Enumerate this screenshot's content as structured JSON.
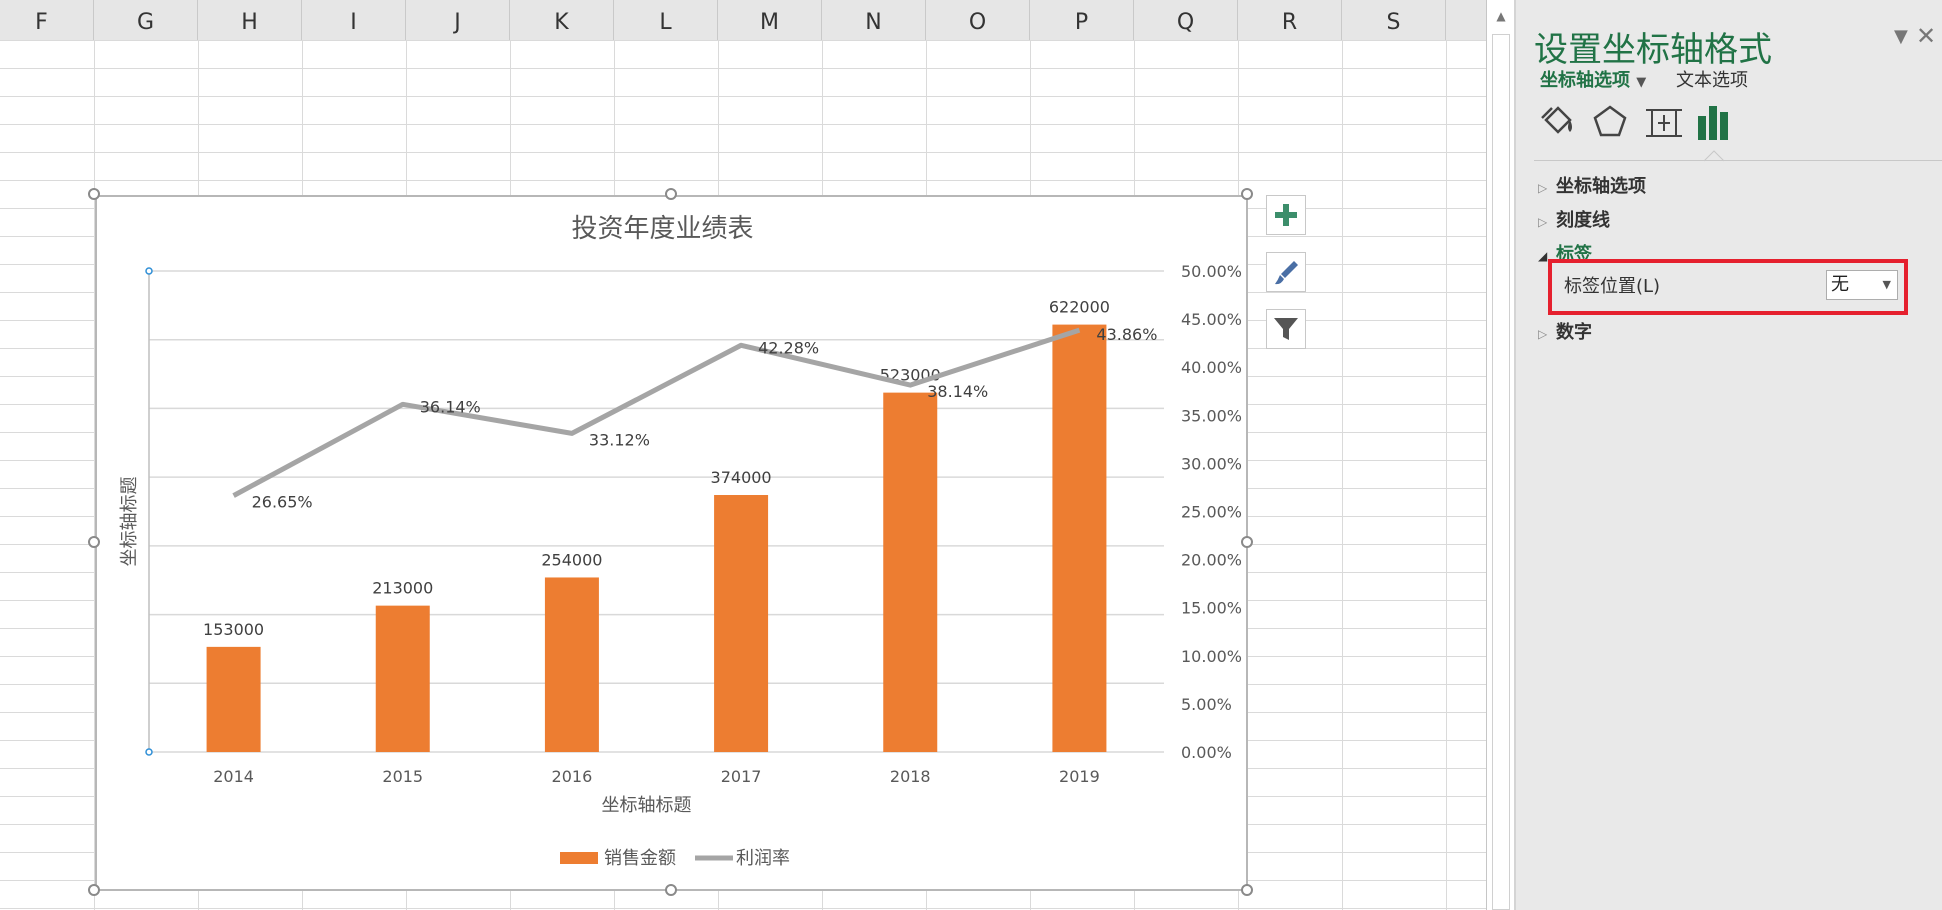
{
  "sheet": {
    "columns": [
      "F",
      "G",
      "H",
      "I",
      "J",
      "K",
      "L",
      "M",
      "N",
      "O",
      "P",
      "Q",
      "R",
      "S"
    ]
  },
  "chart": {
    "side_buttons": [
      {
        "name": "add-chart-element-button",
        "icon": "plus-icon"
      },
      {
        "name": "chart-styles-button",
        "icon": "brush-icon"
      },
      {
        "name": "chart-filters-button",
        "icon": "funnel-icon"
      }
    ]
  },
  "chart_data": {
    "type": "bar+line",
    "title": "投资年度业绩表",
    "categories": [
      "2014",
      "2015",
      "2016",
      "2017",
      "2018",
      "2019"
    ],
    "series": [
      {
        "name": "销售金额",
        "type": "bar",
        "axis": "left",
        "color": "#ED7D31",
        "values": [
          153000,
          213000,
          254000,
          374000,
          523000,
          622000
        ],
        "labels": [
          "153000",
          "213000",
          "254000",
          "374000",
          "523000",
          "622000"
        ]
      },
      {
        "name": "利润率",
        "type": "line",
        "axis": "right",
        "color": "#A5A5A5",
        "values": [
          26.65,
          36.14,
          33.12,
          42.28,
          38.14,
          43.86
        ],
        "labels": [
          "26.65%",
          "36.14%",
          "33.12%",
          "42.28%",
          "38.14%",
          "43.86%"
        ]
      }
    ],
    "xlabel": "坐标轴标题",
    "ylabel": "坐标轴标题",
    "ylim_left": [
      0,
      700000
    ],
    "ylim_right": [
      0,
      50
    ],
    "right_ticks": [
      "0.00%",
      "5.00%",
      "10.00%",
      "15.00%",
      "20.00%",
      "25.00%",
      "30.00%",
      "35.00%",
      "40.00%",
      "45.00%",
      "50.00%"
    ],
    "left_axis_tick_labels": "none",
    "grid": true,
    "legend_position": "bottom"
  },
  "panel": {
    "title": "设置坐标轴格式",
    "tabs": {
      "axis_options": "坐标轴选项",
      "text_options": "文本选项"
    },
    "sections": {
      "axis_options": "坐标轴选项",
      "tick_marks": "刻度线",
      "labels": "标签",
      "number": "数字"
    },
    "label_position": {
      "label": "标签位置(L)",
      "value": "无"
    },
    "accent_color": "#217346"
  }
}
